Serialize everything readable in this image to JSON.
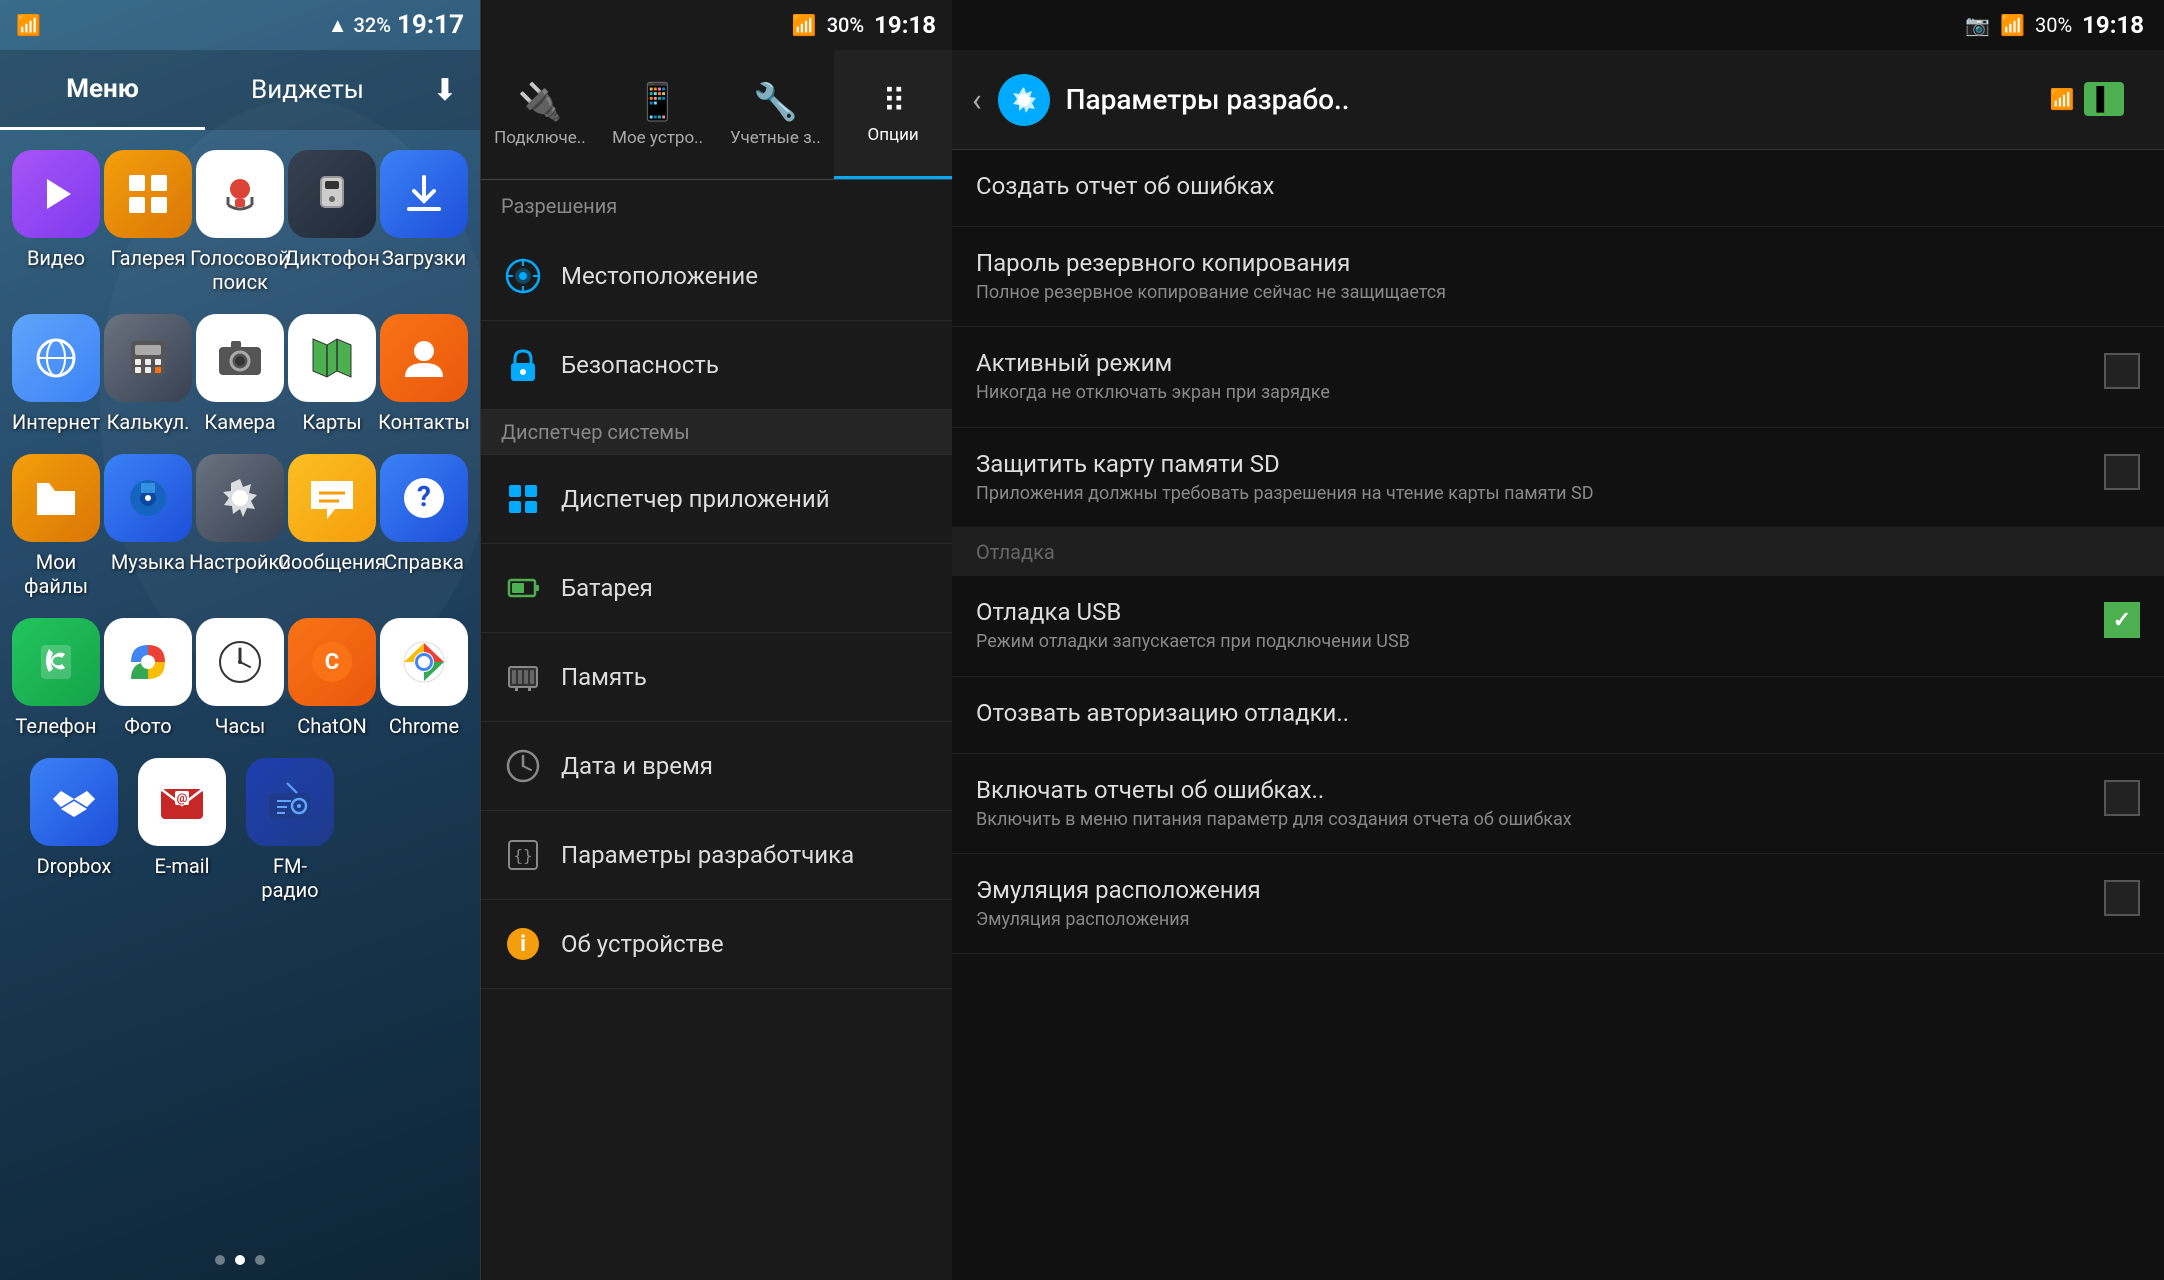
{
  "panel1": {
    "statusBar": {
      "wifi": "WiFi",
      "signal": "Signal",
      "battery": "32%",
      "time": "19:17"
    },
    "tabs": [
      {
        "id": "menu",
        "label": "Меню",
        "active": true
      },
      {
        "id": "widgets",
        "label": "Виджеты",
        "active": false
      },
      {
        "id": "download",
        "label": "⬇",
        "active": false
      }
    ],
    "appRows": [
      [
        {
          "id": "video",
          "label": "Видео",
          "icon": "video"
        },
        {
          "id": "gallery",
          "label": "Галерея",
          "icon": "gallery"
        },
        {
          "id": "voice",
          "label": "Голосовой поиск",
          "icon": "voice"
        },
        {
          "id": "recorder",
          "label": "Диктофон",
          "icon": "recorder"
        },
        {
          "id": "downloads",
          "label": "Загрузки",
          "icon": "downloads"
        }
      ],
      [
        {
          "id": "internet",
          "label": "Интернет",
          "icon": "internet"
        },
        {
          "id": "calc",
          "label": "Калькул.",
          "icon": "calc"
        },
        {
          "id": "camera",
          "label": "Камера",
          "icon": "camera"
        },
        {
          "id": "maps",
          "label": "Карты",
          "icon": "maps"
        },
        {
          "id": "contacts",
          "label": "Контакты",
          "icon": "contacts"
        }
      ],
      [
        {
          "id": "myfiles",
          "label": "Мои файлы",
          "icon": "myfiles"
        },
        {
          "id": "music",
          "label": "Музыка",
          "icon": "music"
        },
        {
          "id": "settings",
          "label": "Настройки",
          "icon": "settings"
        },
        {
          "id": "messages",
          "label": "Сообщения",
          "icon": "messages"
        },
        {
          "id": "help",
          "label": "Справка",
          "icon": "help"
        }
      ],
      [
        {
          "id": "phone",
          "label": "Телефон",
          "icon": "phone"
        },
        {
          "id": "photos",
          "label": "Фото",
          "icon": "photos"
        },
        {
          "id": "clock",
          "label": "Часы",
          "icon": "clock"
        },
        {
          "id": "chaton",
          "label": "ChatON",
          "icon": "chaton"
        },
        {
          "id": "chrome",
          "label": "Chrome",
          "icon": "chrome"
        }
      ],
      [
        {
          "id": "dropbox",
          "label": "Dropbox",
          "icon": "dropbox"
        },
        {
          "id": "email",
          "label": "E-mail",
          "icon": "email"
        },
        {
          "id": "fmradio",
          "label": "FM-радио",
          "icon": "fmradio"
        }
      ]
    ],
    "dots": [
      {
        "active": false
      },
      {
        "active": true
      },
      {
        "active": false
      }
    ]
  },
  "panel2": {
    "statusBar": {
      "battery": "30%",
      "time": "19:18"
    },
    "tabs": [
      {
        "id": "connect",
        "label": "Подключе..",
        "icon": "🔌",
        "active": false
      },
      {
        "id": "mydevice",
        "label": "Мое устро..",
        "icon": "📱",
        "active": false
      },
      {
        "id": "accounts",
        "label": "Учетные з..",
        "icon": "🔧",
        "active": false
      },
      {
        "id": "options",
        "label": "Опции",
        "icon": "⠿",
        "active": true
      }
    ],
    "sectionHeader": "Разрешения",
    "items": [
      {
        "id": "location",
        "label": "Местоположение",
        "icon": "🌐",
        "isSection": false
      },
      {
        "id": "security",
        "label": "Безопасность",
        "icon": "🔒",
        "isSection": false
      },
      {
        "id": "sysmanager-header",
        "label": "Диспетчер системы",
        "isSection": true
      },
      {
        "id": "appmanager",
        "label": "Диспетчер приложений",
        "icon": "⊞",
        "isSection": false
      },
      {
        "id": "battery",
        "label": "Батарея",
        "icon": "🔋",
        "isSection": false
      },
      {
        "id": "memory",
        "label": "Память",
        "icon": "💾",
        "isSection": false
      },
      {
        "id": "datetime",
        "label": "Дата и время",
        "icon": "🕐",
        "isSection": false
      },
      {
        "id": "devparams",
        "label": "Параметры разработчика",
        "icon": "{}",
        "isSection": false
      },
      {
        "id": "aboutdevice",
        "label": "Об устройстве",
        "icon": "ℹ",
        "isSection": false
      }
    ]
  },
  "panel3": {
    "statusBar": {
      "battery": "30%",
      "time": "19:18"
    },
    "header": {
      "title": "Параметры разрабо..",
      "batteryLevel": "I",
      "batteryColor": "#4caf50"
    },
    "options": [
      {
        "id": "create-report",
        "title": "Создать отчет об ошибках",
        "desc": "",
        "hasCheckbox": false,
        "checked": false,
        "isSection": false
      },
      {
        "id": "backup-password",
        "title": "Пароль резервного копирования",
        "desc": "Полное резервное копирование сейчас не защищается",
        "hasCheckbox": false,
        "checked": false,
        "isSection": false
      },
      {
        "id": "active-mode",
        "title": "Активный режим",
        "desc": "Никогда не отключать экран при зарядке",
        "hasCheckbox": true,
        "checked": false,
        "isSection": false
      },
      {
        "id": "protect-sd",
        "title": "Защитить карту памяти SD",
        "desc": "Приложения должны требовать разрешения на чтение карты памяти SD",
        "hasCheckbox": true,
        "checked": false,
        "isSection": false
      },
      {
        "id": "debug-section",
        "title": "Отладка",
        "desc": "",
        "hasCheckbox": false,
        "checked": false,
        "isSection": true
      },
      {
        "id": "usb-debug",
        "title": "Отладка USB",
        "desc": "Режим отладки запускается при подключении USB",
        "hasCheckbox": true,
        "checked": true,
        "isSection": false
      },
      {
        "id": "revoke-auth",
        "title": "Отозвать авторизацию отладки..",
        "desc": "",
        "hasCheckbox": false,
        "checked": false,
        "isSection": false
      },
      {
        "id": "error-reports",
        "title": "Включать отчеты об ошибках..",
        "desc": "Включить в меню питания параметр для создания отчета об ошибках",
        "hasCheckbox": true,
        "checked": false,
        "isSection": false
      },
      {
        "id": "emulate-location",
        "title": "Эмуляция расположения",
        "desc": "Эмуляция расположения",
        "hasCheckbox": true,
        "checked": false,
        "isSection": false
      }
    ]
  }
}
